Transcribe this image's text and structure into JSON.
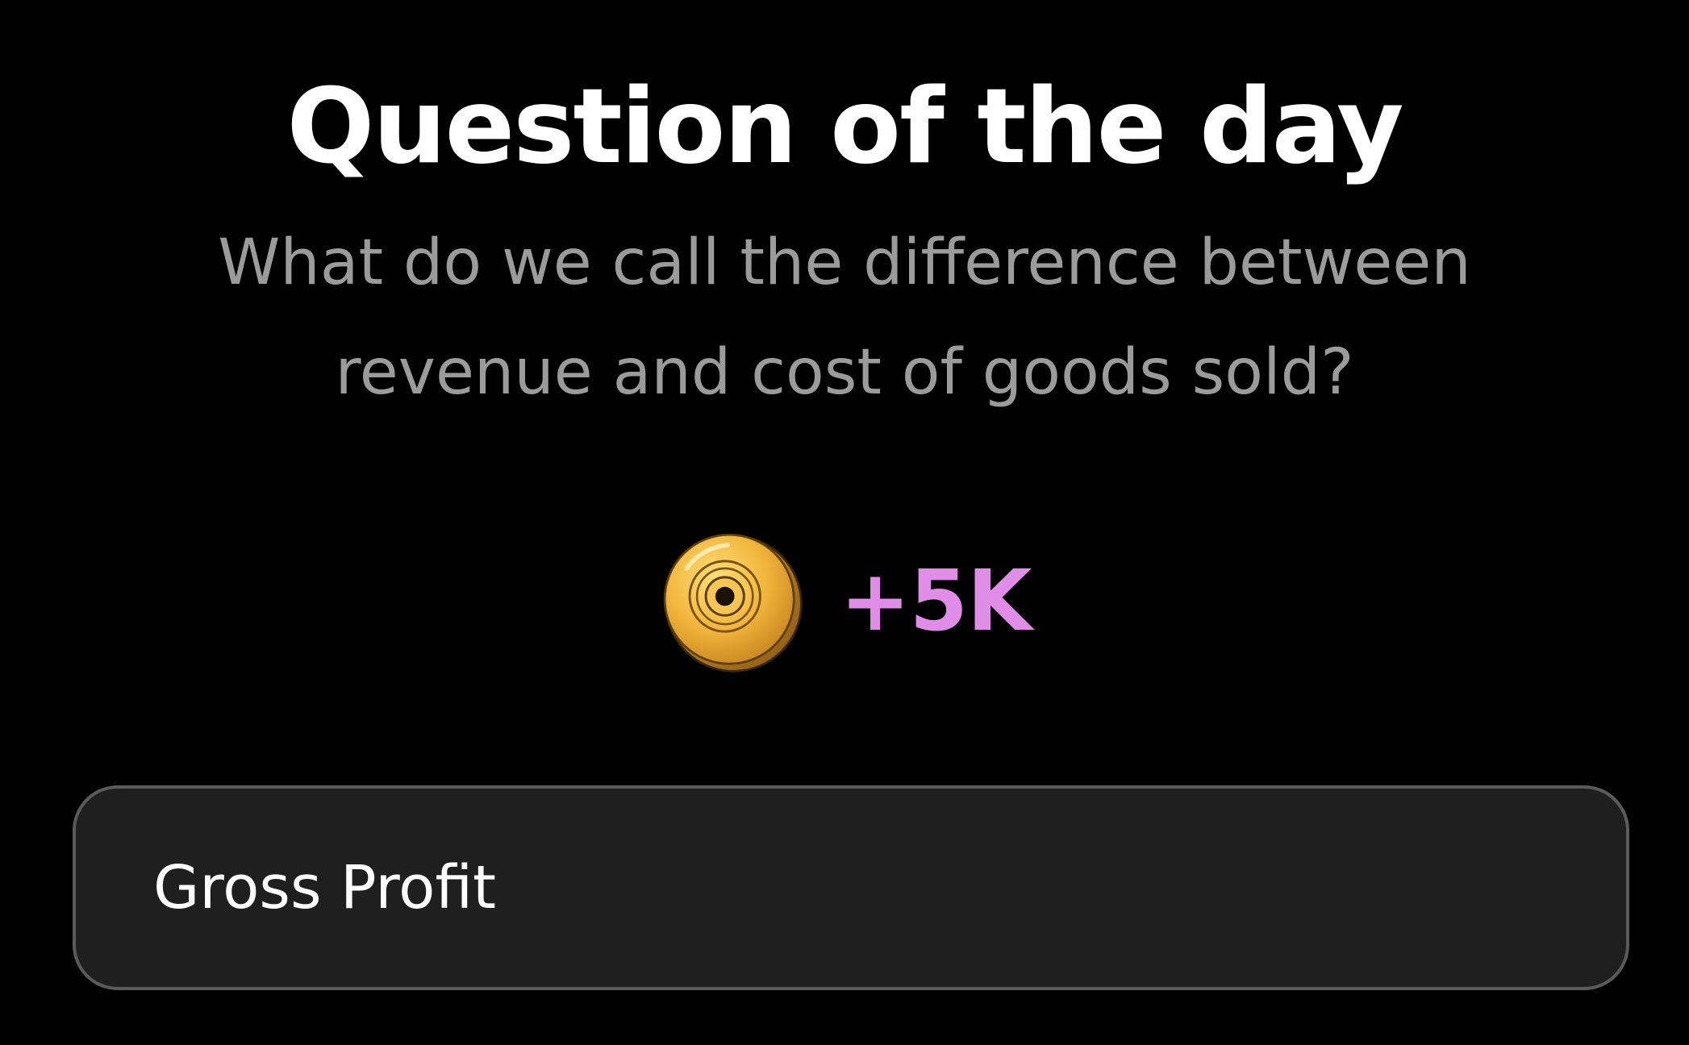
{
  "quiz": {
    "title": "Question of the day",
    "question": "What do we call the difference between revenue and cost of goods sold?"
  },
  "reward": {
    "icon": "gold-coin-icon",
    "amount": "+5K",
    "amount_color": "#e08de8"
  },
  "answer": {
    "option_label": "Gross Profit"
  },
  "colors": {
    "background": "#000000",
    "title": "#ffffff",
    "question": "#9b9b9b",
    "answer_background": "#1f1f1f",
    "answer_border": "#5a5a5a"
  }
}
